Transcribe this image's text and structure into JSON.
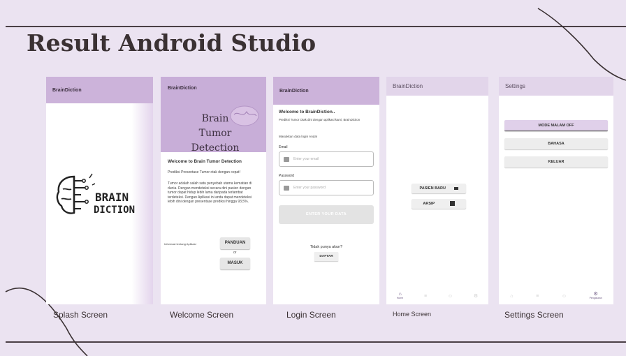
{
  "slide": {
    "title": "Result Android Studio"
  },
  "captions": [
    "Splash Screen",
    "Welcome Screen",
    "Login Screen",
    "Home Screen",
    "Settings Screen"
  ],
  "splash": {
    "app_name": "BrainDiction",
    "logo_line1": "BRAIN",
    "logo_line2": "DICTION"
  },
  "welcome": {
    "app_name": "BrainDiction",
    "hero_line1": "Brain Tumor",
    "hero_line2": "Detection",
    "heading": "Welcome to Brain Tumor Detection",
    "tagline": "Prediksi Presentase Tumor otak dengan cepat!",
    "body": "Tumor adalah salah satu penyebab utama kematian di dunia. Dengan mendeteksi secara dini pasien dengan tumor dapat hidup lebih lama daripada terlambat terdeteksi. Dengan Aplikasi ini anda dapat mendeteksi lebih dini dengan presentase prediksi hingga 93,5%.",
    "info_label": "Informasi tentang Aplikasi",
    "guide_button": "PANDUAN",
    "or_text": "or",
    "login_button": "MASUK"
  },
  "login": {
    "app_name": "BrainDiction",
    "heading": "Welcome to BrainDiction..",
    "subtitle": "Prediksi Tumor Otak dini dengan aplikasi kami, BrainDiction",
    "prompt": "Masukkan data login Anda!",
    "email_label": "Email",
    "email_placeholder": "Enter your email",
    "password_label": "Password",
    "password_placeholder": "Enter your password",
    "submit": "ENTER YOUR DATA",
    "no_account": "Tidak punya akun?",
    "register": "DAFTAR"
  },
  "home": {
    "app_name": "BrainDiction",
    "new_patient": "PASIEN BARU",
    "archive": "ARSIP",
    "nav_home": "Home"
  },
  "settings": {
    "title": "Settings",
    "dark_mode": "MODE MALAM OFF",
    "language": "BAHASA",
    "logout": "KELUAR",
    "nav_settings": "Pengaturan"
  }
}
